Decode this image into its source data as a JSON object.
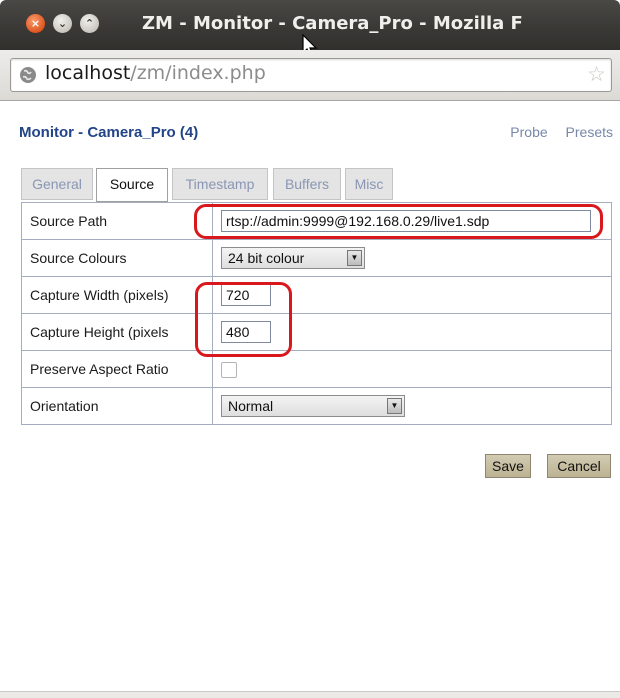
{
  "window": {
    "title": "ZM - Monitor - Camera_Pro - Mozilla F",
    "close_glyph": "×",
    "minimize_glyph": "⌄",
    "maximize_glyph": "⌃"
  },
  "address_bar": {
    "host": "localhost",
    "path": "/zm/index.php"
  },
  "page": {
    "title": "Monitor - Camera_Pro (4)",
    "links": [
      "Probe",
      "Presets"
    ]
  },
  "tabs": [
    {
      "label": "General",
      "active": false
    },
    {
      "label": "Source",
      "active": true
    },
    {
      "label": "Timestamp",
      "active": false
    },
    {
      "label": "Buffers",
      "active": false
    },
    {
      "label": "Misc",
      "active": false
    }
  ],
  "fields": {
    "source_path": {
      "label": "Source Path",
      "value": "rtsp://admin:9999@192.168.0.29/live1.sdp"
    },
    "source_colours": {
      "label": "Source Colours",
      "value": "24 bit colour"
    },
    "capture_width": {
      "label": "Capture Width (pixels)",
      "value": "720"
    },
    "capture_height": {
      "label": "Capture Height (pixels",
      "value": "480"
    },
    "preserve_aspect": {
      "label": "Preserve Aspect Ratio",
      "checked": false
    },
    "orientation": {
      "label": "Orientation",
      "value": "Normal"
    }
  },
  "buttons": {
    "save": "Save",
    "cancel": "Cancel"
  },
  "colors": {
    "accent_title": "#224488",
    "annotation": "#d9181e",
    "button": "#c9c0a4"
  }
}
